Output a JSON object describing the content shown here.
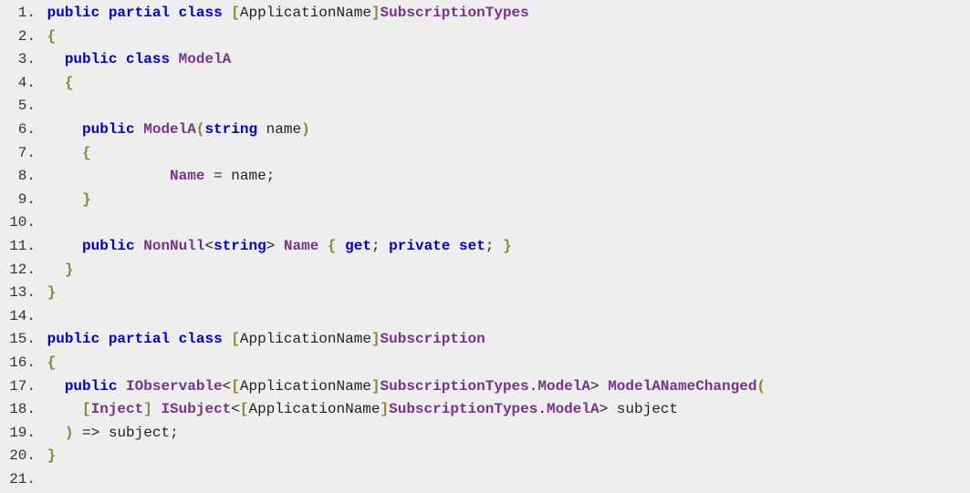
{
  "code": {
    "lines": [
      {
        "num": "1.",
        "tokens": [
          {
            "t": "kw",
            "v": "public"
          },
          {
            "t": "sp",
            "v": " "
          },
          {
            "t": "kw",
            "v": "partial"
          },
          {
            "t": "sp",
            "v": " "
          },
          {
            "t": "kw",
            "v": "class"
          },
          {
            "t": "sp",
            "v": " "
          },
          {
            "t": "brace",
            "v": "["
          },
          {
            "t": "ident",
            "v": "ApplicationName"
          },
          {
            "t": "brace",
            "v": "]"
          },
          {
            "t": "type",
            "v": "SubscriptionTypes"
          }
        ]
      },
      {
        "num": "2.",
        "tokens": [
          {
            "t": "brace",
            "v": "{"
          }
        ]
      },
      {
        "num": "3.",
        "tokens": [
          {
            "t": "sp",
            "v": "  "
          },
          {
            "t": "kw",
            "v": "public"
          },
          {
            "t": "sp",
            "v": " "
          },
          {
            "t": "kw",
            "v": "class"
          },
          {
            "t": "sp",
            "v": " "
          },
          {
            "t": "type",
            "v": "ModelA"
          }
        ]
      },
      {
        "num": "4.",
        "tokens": [
          {
            "t": "sp",
            "v": "  "
          },
          {
            "t": "brace",
            "v": "{"
          }
        ]
      },
      {
        "num": "5.",
        "tokens": []
      },
      {
        "num": "6.",
        "tokens": [
          {
            "t": "sp",
            "v": "    "
          },
          {
            "t": "kw",
            "v": "public"
          },
          {
            "t": "sp",
            "v": " "
          },
          {
            "t": "type",
            "v": "ModelA"
          },
          {
            "t": "brace",
            "v": "("
          },
          {
            "t": "kw",
            "v": "string"
          },
          {
            "t": "sp",
            "v": " "
          },
          {
            "t": "ident",
            "v": "name"
          },
          {
            "t": "brace",
            "v": ")"
          }
        ]
      },
      {
        "num": "7.",
        "tokens": [
          {
            "t": "sp",
            "v": "    "
          },
          {
            "t": "brace",
            "v": "{"
          }
        ]
      },
      {
        "num": "8.",
        "tokens": [
          {
            "t": "sp",
            "v": "              "
          },
          {
            "t": "prop",
            "v": "Name"
          },
          {
            "t": "sp",
            "v": " "
          },
          {
            "t": "punct",
            "v": "="
          },
          {
            "t": "sp",
            "v": " "
          },
          {
            "t": "ident",
            "v": "name"
          },
          {
            "t": "punct",
            "v": ";"
          }
        ]
      },
      {
        "num": "9.",
        "tokens": [
          {
            "t": "sp",
            "v": "    "
          },
          {
            "t": "brace",
            "v": "}"
          }
        ]
      },
      {
        "num": "10.",
        "tokens": []
      },
      {
        "num": "11.",
        "tokens": [
          {
            "t": "sp",
            "v": "    "
          },
          {
            "t": "kw",
            "v": "public"
          },
          {
            "t": "sp",
            "v": " "
          },
          {
            "t": "type",
            "v": "NonNull"
          },
          {
            "t": "punct",
            "v": "<"
          },
          {
            "t": "kw",
            "v": "string"
          },
          {
            "t": "punct",
            "v": ">"
          },
          {
            "t": "sp",
            "v": " "
          },
          {
            "t": "prop",
            "v": "Name"
          },
          {
            "t": "sp",
            "v": " "
          },
          {
            "t": "brace",
            "v": "{"
          },
          {
            "t": "sp",
            "v": " "
          },
          {
            "t": "kw",
            "v": "get"
          },
          {
            "t": "punct",
            "v": ";"
          },
          {
            "t": "sp",
            "v": " "
          },
          {
            "t": "kw",
            "v": "private"
          },
          {
            "t": "sp",
            "v": " "
          },
          {
            "t": "kw",
            "v": "set"
          },
          {
            "t": "punct",
            "v": ";"
          },
          {
            "t": "sp",
            "v": " "
          },
          {
            "t": "brace",
            "v": "}"
          }
        ]
      },
      {
        "num": "12.",
        "tokens": [
          {
            "t": "sp",
            "v": "  "
          },
          {
            "t": "brace",
            "v": "}"
          }
        ]
      },
      {
        "num": "13.",
        "tokens": [
          {
            "t": "brace",
            "v": "}"
          }
        ]
      },
      {
        "num": "14.",
        "tokens": []
      },
      {
        "num": "15.",
        "tokens": [
          {
            "t": "kw",
            "v": "public"
          },
          {
            "t": "sp",
            "v": " "
          },
          {
            "t": "kw",
            "v": "partial"
          },
          {
            "t": "sp",
            "v": " "
          },
          {
            "t": "kw",
            "v": "class"
          },
          {
            "t": "sp",
            "v": " "
          },
          {
            "t": "brace",
            "v": "["
          },
          {
            "t": "ident",
            "v": "ApplicationName"
          },
          {
            "t": "brace",
            "v": "]"
          },
          {
            "t": "type",
            "v": "Subscription"
          }
        ]
      },
      {
        "num": "16.",
        "tokens": [
          {
            "t": "brace",
            "v": "{"
          }
        ]
      },
      {
        "num": "17.",
        "tokens": [
          {
            "t": "sp",
            "v": "  "
          },
          {
            "t": "kw",
            "v": "public"
          },
          {
            "t": "sp",
            "v": " "
          },
          {
            "t": "type",
            "v": "IObservable"
          },
          {
            "t": "punct",
            "v": "<"
          },
          {
            "t": "brace",
            "v": "["
          },
          {
            "t": "ident",
            "v": "ApplicationName"
          },
          {
            "t": "brace",
            "v": "]"
          },
          {
            "t": "type",
            "v": "SubscriptionTypes"
          },
          {
            "t": "punct",
            "v": "."
          },
          {
            "t": "type",
            "v": "ModelA"
          },
          {
            "t": "punct",
            "v": ">"
          },
          {
            "t": "sp",
            "v": " "
          },
          {
            "t": "method",
            "v": "ModelANameChanged"
          },
          {
            "t": "brace",
            "v": "("
          }
        ]
      },
      {
        "num": "18.",
        "tokens": [
          {
            "t": "sp",
            "v": "    "
          },
          {
            "t": "brace",
            "v": "["
          },
          {
            "t": "type",
            "v": "Inject"
          },
          {
            "t": "brace",
            "v": "]"
          },
          {
            "t": "sp",
            "v": " "
          },
          {
            "t": "type",
            "v": "ISubject"
          },
          {
            "t": "punct",
            "v": "<"
          },
          {
            "t": "brace",
            "v": "["
          },
          {
            "t": "ident",
            "v": "ApplicationName"
          },
          {
            "t": "brace",
            "v": "]"
          },
          {
            "t": "type",
            "v": "SubscriptionTypes"
          },
          {
            "t": "punct",
            "v": "."
          },
          {
            "t": "type",
            "v": "ModelA"
          },
          {
            "t": "punct",
            "v": ">"
          },
          {
            "t": "sp",
            "v": " "
          },
          {
            "t": "ident",
            "v": "subject"
          }
        ]
      },
      {
        "num": "19.",
        "tokens": [
          {
            "t": "sp",
            "v": "  "
          },
          {
            "t": "brace",
            "v": ")"
          },
          {
            "t": "sp",
            "v": " "
          },
          {
            "t": "punct",
            "v": "=>"
          },
          {
            "t": "sp",
            "v": " "
          },
          {
            "t": "ident",
            "v": "subject"
          },
          {
            "t": "punct",
            "v": ";"
          }
        ]
      },
      {
        "num": "20.",
        "tokens": [
          {
            "t": "brace",
            "v": "}"
          }
        ]
      },
      {
        "num": "21.",
        "tokens": []
      }
    ]
  }
}
